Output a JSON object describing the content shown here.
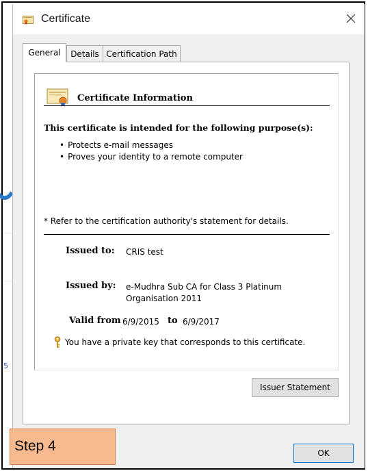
{
  "window": {
    "title": "Certificate",
    "icons": {
      "title": "certificate-icon",
      "close": "close-icon"
    }
  },
  "tabs": [
    {
      "label": "General",
      "active": true
    },
    {
      "label": "Details",
      "active": false
    },
    {
      "label": "Certification Path",
      "active": false
    }
  ],
  "general": {
    "info_title": "Certificate Information",
    "purpose_heading": "This certificate is intended for the following purpose(s):",
    "purposes": [
      "Protects e-mail messages",
      "Proves your identity to a remote computer"
    ],
    "refer_note": "* Refer to the certification authority's statement for details.",
    "issued_to_label": "Issued to:",
    "issued_to_value": "CRIS test",
    "issued_by_label": "Issued by:",
    "issued_by_value_line1": "e-Mudhra Sub CA for Class 3 Platinum",
    "issued_by_value_line2": "Organisation 2011",
    "valid_from_label": "Valid from",
    "valid_from_value": "6/9/2015",
    "valid_to_label": "to",
    "valid_to_value": "6/9/2017",
    "private_key_note": "You have a private key that corresponds to this certificate."
  },
  "buttons": {
    "issuer_statement": "Issuer Statement",
    "ok": "OK"
  },
  "overlay": {
    "step_label": "Step 4",
    "color": "#f7b98e"
  },
  "background": {
    "peek_digit": "5"
  }
}
